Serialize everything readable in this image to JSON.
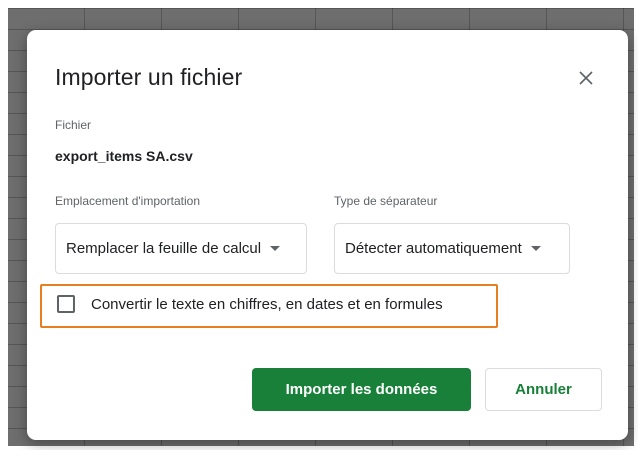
{
  "dialog": {
    "title": "Importer un fichier",
    "close_icon": "close-icon"
  },
  "file": {
    "label": "Fichier",
    "name": "export_items SA.csv"
  },
  "import_location": {
    "label": "Emplacement d'importation",
    "selected": "Remplacer la feuille de calcul"
  },
  "separator_type": {
    "label": "Type de séparateur",
    "selected": "Détecter automatiquement"
  },
  "convert_option": {
    "label": "Convertir le texte en chiffres, en dates et en formules",
    "checked": false
  },
  "buttons": {
    "import": "Importer les données",
    "cancel": "Annuler"
  },
  "colors": {
    "primary": "#188038",
    "highlight": "#e67e22",
    "text": "#202124",
    "secondary_text": "#5f6368"
  }
}
